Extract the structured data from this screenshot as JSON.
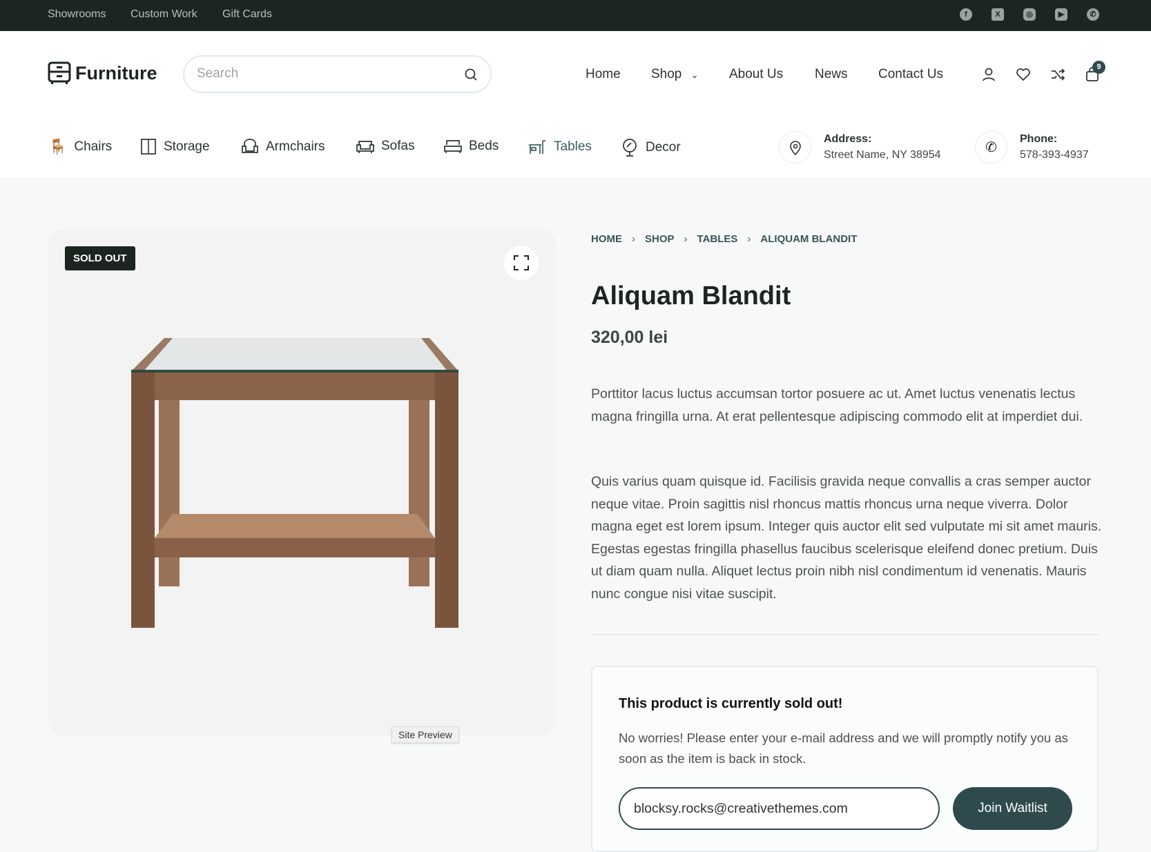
{
  "topbar": {
    "links": [
      "Showrooms",
      "Custom Work",
      "Gift Cards"
    ],
    "social_icons": [
      "facebook-icon",
      "x-twitter-icon",
      "instagram-icon",
      "youtube-icon",
      "whatsapp-icon"
    ]
  },
  "header": {
    "logo": "Furniture",
    "search_placeholder": "Search",
    "nav": [
      "Home",
      "Shop",
      "About Us",
      "News",
      "Contact Us"
    ],
    "cart_count": "9"
  },
  "categories": [
    "Chairs",
    "Storage",
    "Armchairs",
    "Sofas",
    "Beds",
    "Tables",
    "Decor"
  ],
  "active_category": "Tables",
  "contact": {
    "address_label": "Address:",
    "address": "Street Name, NY 38954",
    "phone_label": "Phone:",
    "phone": "578-393-4937"
  },
  "product": {
    "badge": "SOLD OUT",
    "breadcrumb": [
      "HOME",
      "SHOP",
      "TABLES",
      "ALIQUAM BLANDIT"
    ],
    "title": "Aliquam Blandit",
    "price": "320,00 lei",
    "description": [
      "Porttitor lacus luctus accumsan tortor posuere ac ut. Amet luctus venenatis lectus magna fringilla urna. At erat pellentesque adipiscing commodo elit at imperdiet dui.",
      "Quis varius quam quisque id. Facilisis gravida neque convallis a cras semper auctor neque vitae. Proin sagittis nisl rhoncus mattis rhoncus urna neque viverra. Dolor magna eget est lorem ipsum. Integer quis auctor elit sed vulputate mi sit amet mauris. Egestas egestas fringilla phasellus faucibus scelerisque eleifend donec pretium. Duis ut diam quam nulla. Aliquet lectus proin nibh nisl condimentum id venenatis. Mauris nunc congue nisi vitae suscipit."
    ]
  },
  "preview_label": "Site Preview",
  "waitlist": {
    "heading": "This product is currently sold out!",
    "text": "No worries! Please enter your e-mail address and we will promptly notify you as soon as the item is back in stock.",
    "email_value": "blocksy.rocks@creativethemes.com",
    "button": "Join Waitlist"
  },
  "colors": {
    "topbar": "#1d2521",
    "accent": "#2f4a4c",
    "active_category": "#3c5e63"
  }
}
